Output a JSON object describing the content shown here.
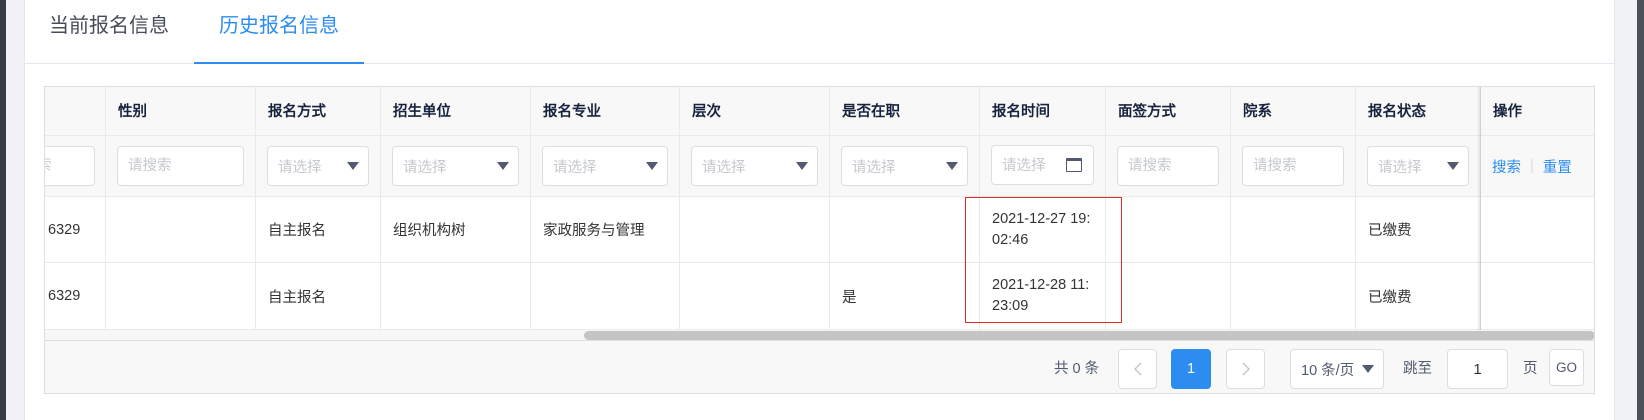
{
  "tabs": [
    {
      "label": "当前报名信息",
      "active": false
    },
    {
      "label": "历史报名信息",
      "active": true
    }
  ],
  "table": {
    "columns": [
      "",
      "性别",
      "报名方式",
      "招生单位",
      "报名专业",
      "层次",
      "是否在职",
      "报名时间",
      "面签方式",
      "院系",
      "报名状态",
      "操作"
    ],
    "filters": [
      {
        "type": "input",
        "placeholder": "请搜索"
      },
      {
        "type": "input",
        "placeholder": "请搜索"
      },
      {
        "type": "select",
        "placeholder": "请选择"
      },
      {
        "type": "select",
        "placeholder": "请选择"
      },
      {
        "type": "select",
        "placeholder": "请选择"
      },
      {
        "type": "select",
        "placeholder": "请选择"
      },
      {
        "type": "select",
        "placeholder": "请选择"
      },
      {
        "type": "date",
        "placeholder": "请选择",
        "icon": "calendar-icon"
      },
      {
        "type": "input",
        "placeholder": "请搜索"
      },
      {
        "type": "input",
        "placeholder": "请搜索"
      },
      {
        "type": "select",
        "placeholder": "请选择"
      },
      {
        "type": "actions",
        "search_label": "搜索",
        "separator": "|",
        "reset_label": "重置"
      }
    ],
    "rows": [
      {
        "cells": [
          "6329",
          "",
          "自主报名",
          "组织机构树",
          "家政服务与管理",
          "",
          "",
          "2021-12-27 19:02:46",
          "",
          "",
          "已缴费",
          ""
        ]
      },
      {
        "cells": [
          "6329",
          "",
          "自主报名",
          "",
          "",
          "",
          "是",
          "2021-12-28 11:23:09",
          "",
          "",
          "已缴费",
          ""
        ]
      }
    ],
    "horizontal_scroll": {
      "visible_fraction": 0.652,
      "position": 1.0
    }
  },
  "pagination": {
    "total_text": "共 0 条",
    "current_page": "1",
    "page_size": "10 条/页",
    "jump_label": "跳至",
    "jump_value": "1",
    "page_suffix": "页",
    "go_label": "GO"
  },
  "icons": {
    "select_arrow": "caret-down-icon",
    "date_picker": "calendar-icon",
    "prev_page": "chevron-left-icon",
    "next_page": "chevron-right-icon"
  },
  "colors": {
    "accent": "#2d8cf0",
    "highlight": "#e02b2b",
    "placeholder": "#c5c8ce"
  }
}
